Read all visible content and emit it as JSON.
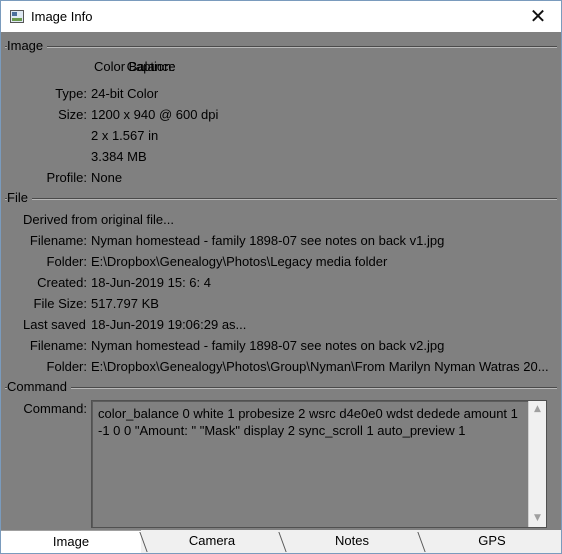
{
  "window": {
    "title": "Image Info",
    "close_glyph": "✕",
    "background_color": "#808080"
  },
  "image_section": {
    "heading": "Image",
    "caption_label": "Caption:",
    "caption_value": "Color Balance",
    "type_label": "Type:",
    "type_value": "24-bit Color",
    "size_label": "Size:",
    "size_value_1": "1200 x 940 @ 600 dpi",
    "size_value_2": "2 x 1.567 in",
    "size_value_3": "3.384 MB",
    "profile_label": "Profile:",
    "profile_value": "None"
  },
  "file_section": {
    "heading": "File",
    "derived_text": "Derived from original file...",
    "filename_label": "Filename:",
    "filename_value": "Nyman homestead - family 1898-07 see notes on back v1.jpg",
    "folder_label": "Folder:",
    "folder_value": "E:\\Dropbox\\Genealogy\\Photos\\Legacy media folder",
    "created_label": "Created:",
    "created_value": "18-Jun-2019  15: 6: 4",
    "filesize_label": "File Size:",
    "filesize_value": "517.797 KB",
    "lastsaved_label": "Last saved",
    "lastsaved_value": "18-Jun-2019 19:06:29 as...",
    "filename2_label": "Filename:",
    "filename2_value": "Nyman homestead - family 1898-07 see notes on back v2.jpg",
    "folder2_label": "Folder:",
    "folder2_value": "E:\\Dropbox\\Genealogy\\Photos\\Group\\Nyman\\From Marilyn Nyman Watras 20..."
  },
  "command_section": {
    "heading": "Command",
    "command_label": "Command:",
    "command_text": "color_balance 0 white 1 probesize 2 wsrc d4e0e0 wdst dedede amount 1 -1 0 0 \"Amount: \" \"Mask\" display 2 sync_scroll 1 auto_preview 1"
  },
  "scrollbar": {
    "up_glyph": "▲",
    "down_glyph": "▼"
  },
  "tabs": [
    {
      "label": "Image",
      "active": true
    },
    {
      "label": "Camera",
      "active": false
    },
    {
      "label": "Notes",
      "active": false
    },
    {
      "label": "GPS",
      "active": false
    }
  ],
  "icons": {
    "app": "image-window-icon",
    "close": "close-icon"
  }
}
